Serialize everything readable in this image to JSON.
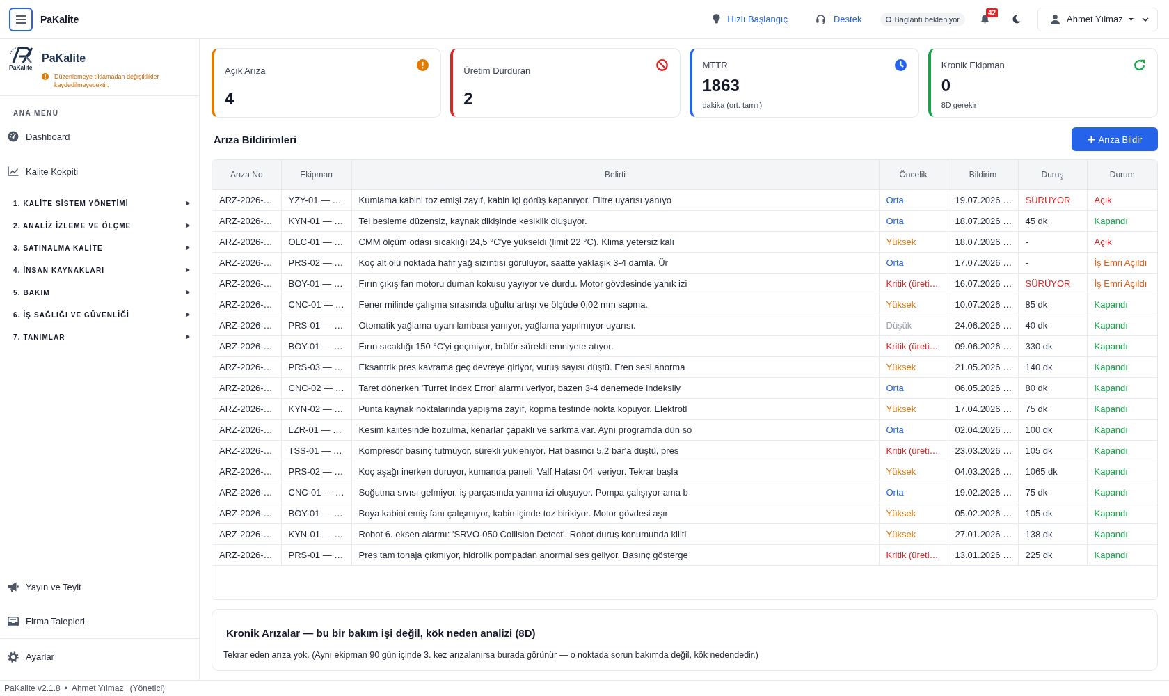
{
  "topbar": {
    "brand": "PaKalite",
    "links": [
      "Hızlı Başlangıç",
      "Destek"
    ],
    "connection_status": "Bağlantı bekleniyor",
    "notification_count": "42",
    "user": "Ahmet Yılmaz"
  },
  "sidebar": {
    "logo_caption": "PaKalite",
    "title": "PaKalite",
    "notice": "Düzenlemeye tıklamadan değişiklikler kaydedilmeyecektir.",
    "menu_heading": "ANA MENÜ",
    "items": [
      {
        "label": "Dashboard"
      },
      {
        "label": "Kalite Kokpiti"
      }
    ],
    "sections": [
      {
        "label": "1. KALİTE SİSTEM YÖNETİMİ",
        "expanded": false
      },
      {
        "label": "2. ANALİZ İZLEME VE ÖLÇME",
        "expanded": false
      },
      {
        "label": "3. SATINALMA KALİTE",
        "expanded": false
      },
      {
        "label": "4. İNSAN KAYNAKLARI",
        "expanded": false
      },
      {
        "label": "5. BAKIM",
        "expanded": false
      },
      {
        "label": "6. İŞ SAĞLIĞI VE GÜVENLİĞİ",
        "expanded": false
      },
      {
        "label": "7. TANIMLAR",
        "expanded": false
      }
    ],
    "bottom_items": [
      {
        "label": "Yayın ve Teyit"
      },
      {
        "label": "Firma Talepleri"
      }
    ],
    "settings": "Ayarlar"
  },
  "kpis": [
    {
      "title": "Açık Arıza",
      "value": "4",
      "color": "#e07b00"
    },
    {
      "title": "Üretim Durduran",
      "value": "2",
      "color": "#dc2626"
    },
    {
      "title": "MTTR",
      "value": "1863",
      "subtitle": "dakika (ort. tamir)",
      "color": "#2563eb"
    },
    {
      "title": "Kronik Ekipman",
      "value": "0",
      "subtitle": "8D gerekir",
      "color": "#16a34a"
    }
  ],
  "faults": {
    "title": "Arıza Bildirimleri",
    "add_button": "Arıza Bildir",
    "table": {
      "columns": [
        "Arıza No",
        "Ekipman",
        "Belirti",
        "Öncelik",
        "Bildirim",
        "Duruş",
        "Durum"
      ],
      "rows": [
        {
          "id": "ARZ-2026-…",
          "equipment": "YZY-01 — …",
          "symptom": "Kumlama kabini toz emişi zayıf, kabin içi görüş kapanıyor. Filtre uyarısı yanıyo",
          "priority": {
            "text": "Orta",
            "color": "#2563eb"
          },
          "reported": "19.07.2026 …",
          "downtime": {
            "text": "SÜRÜYOR",
            "ongoing": true
          },
          "status": {
            "text": "Açık",
            "color": "#dc2626"
          }
        },
        {
          "id": "ARZ-2026-…",
          "equipment": "KYN-01 — …",
          "symptom": "Tel besleme düzensiz, kaynak dikişinde kesiklik oluşuyor.",
          "priority": {
            "text": "Orta",
            "color": "#2563eb"
          },
          "reported": "18.07.2026 …",
          "downtime": {
            "text": "45 dk",
            "ongoing": false
          },
          "status": {
            "text": "Kapandı",
            "color": "#16a34a"
          }
        },
        {
          "id": "ARZ-2026-…",
          "equipment": "OLC-01 — …",
          "symptom": "CMM ölçüm odası sıcaklığı 24,5 °C'ye yükseldi (limit 22 °C). Klima yetersiz kalı",
          "priority": {
            "text": "Yüksek",
            "color": "#d97706"
          },
          "reported": "18.07.2026 …",
          "downtime": {
            "text": "-",
            "ongoing": false
          },
          "status": {
            "text": "Açık",
            "color": "#dc2626"
          }
        },
        {
          "id": "ARZ-2026-…",
          "equipment": "PRS-02 — …",
          "symptom": "Koç alt ölü noktada hafif yağ sızıntısı görülüyor, saatte yaklaşık 3-4 damla. Ür",
          "priority": {
            "text": "Orta",
            "color": "#2563eb"
          },
          "reported": "17.07.2026 …",
          "downtime": {
            "text": "-",
            "ongoing": false
          },
          "status": {
            "text": "İş Emri Açıldı",
            "color": "#ea580c"
          }
        },
        {
          "id": "ARZ-2026-…",
          "equipment": "BOY-01 — …",
          "symptom": "Fırın çıkış fan motoru duman kokusu yayıyor ve durdu. Motor gövdesinde yanık izi",
          "priority": {
            "text": "Kritik (üreti…",
            "color": "#dc2626"
          },
          "reported": "16.07.2026 …",
          "downtime": {
            "text": "SÜRÜYOR",
            "ongoing": true
          },
          "status": {
            "text": "İş Emri Açıldı",
            "color": "#ea580c"
          }
        },
        {
          "id": "ARZ-2026-…",
          "equipment": "CNC-01 — …",
          "symptom": "Fener milinde çalışma sırasında uğultu artışı ve ölçüde 0,02 mm sapma.",
          "priority": {
            "text": "Yüksek",
            "color": "#d97706"
          },
          "reported": "10.07.2026 …",
          "downtime": {
            "text": "85 dk",
            "ongoing": false
          },
          "status": {
            "text": "Kapandı",
            "color": "#16a34a"
          }
        },
        {
          "id": "ARZ-2026-…",
          "equipment": "PRS-01 — …",
          "symptom": "Otomatik yağlama uyarı lambası yanıyor, yağlama yapılmıyor uyarısı.",
          "priority": {
            "text": "Düşük",
            "color": "#9ca3af"
          },
          "reported": "24.06.2026 …",
          "downtime": {
            "text": "40 dk",
            "ongoing": false
          },
          "status": {
            "text": "Kapandı",
            "color": "#16a34a"
          }
        },
        {
          "id": "ARZ-2026-…",
          "equipment": "BOY-01 — …",
          "symptom": "Fırın sıcaklığı 150 °C'yi geçmiyor, brülör sürekli emniyete atıyor.",
          "priority": {
            "text": "Kritik (üreti…",
            "color": "#dc2626"
          },
          "reported": "09.06.2026 …",
          "downtime": {
            "text": "330 dk",
            "ongoing": false
          },
          "status": {
            "text": "Kapandı",
            "color": "#16a34a"
          }
        },
        {
          "id": "ARZ-2026-…",
          "equipment": "PRS-03 — …",
          "symptom": "Eksantrik pres kavrama geç devreye giriyor, vuruş sayısı düştü. Fren sesi anorma",
          "priority": {
            "text": "Yüksek",
            "color": "#d97706"
          },
          "reported": "21.05.2026 …",
          "downtime": {
            "text": "140 dk",
            "ongoing": false
          },
          "status": {
            "text": "Kapandı",
            "color": "#16a34a"
          }
        },
        {
          "id": "ARZ-2026-…",
          "equipment": "CNC-02 — …",
          "symptom": "Taret dönerken 'Turret Index Error' alarmı veriyor, bazen 3-4 denemede indeksliy",
          "priority": {
            "text": "Orta",
            "color": "#2563eb"
          },
          "reported": "06.05.2026 …",
          "downtime": {
            "text": "80 dk",
            "ongoing": false
          },
          "status": {
            "text": "Kapandı",
            "color": "#16a34a"
          }
        },
        {
          "id": "ARZ-2026-…",
          "equipment": "KYN-02 — …",
          "symptom": "Punta kaynak noktalarında yapışma zayıf, kopma testinde nokta kopuyor. Elektrotl",
          "priority": {
            "text": "Yüksek",
            "color": "#d97706"
          },
          "reported": "17.04.2026 …",
          "downtime": {
            "text": "75 dk",
            "ongoing": false
          },
          "status": {
            "text": "Kapandı",
            "color": "#16a34a"
          }
        },
        {
          "id": "ARZ-2026-…",
          "equipment": "LZR-01 — …",
          "symptom": "Kesim kalitesinde bozulma, kenarlar çapaklı ve sarkma var. Aynı programda dün so",
          "priority": {
            "text": "Orta",
            "color": "#2563eb"
          },
          "reported": "02.04.2026 …",
          "downtime": {
            "text": "100 dk",
            "ongoing": false
          },
          "status": {
            "text": "Kapandı",
            "color": "#16a34a"
          }
        },
        {
          "id": "ARZ-2026-…",
          "equipment": "TSS-01 — …",
          "symptom": "Kompresör basınç tutmuyor, sürekli yükleniyor. Hat basıncı 5,2 bar'a düştü, pres",
          "priority": {
            "text": "Kritik (üreti…",
            "color": "#dc2626"
          },
          "reported": "23.03.2026 …",
          "downtime": {
            "text": "105 dk",
            "ongoing": false
          },
          "status": {
            "text": "Kapandı",
            "color": "#16a34a"
          }
        },
        {
          "id": "ARZ-2026-…",
          "equipment": "PRS-02 — …",
          "symptom": "Koç aşağı inerken duruyor, kumanda paneli 'Valf Hatası 04' veriyor. Tekrar başla",
          "priority": {
            "text": "Yüksek",
            "color": "#d97706"
          },
          "reported": "04.03.2026 …",
          "downtime": {
            "text": "1065 dk",
            "ongoing": false
          },
          "status": {
            "text": "Kapandı",
            "color": "#16a34a"
          }
        },
        {
          "id": "ARZ-2026-…",
          "equipment": "CNC-01 — …",
          "symptom": "Soğutma sıvısı gelmiyor, iş parçasında yanma izi oluşuyor. Pompa çalışıyor ama b",
          "priority": {
            "text": "Orta",
            "color": "#2563eb"
          },
          "reported": "19.02.2026 …",
          "downtime": {
            "text": "75 dk",
            "ongoing": false
          },
          "status": {
            "text": "Kapandı",
            "color": "#16a34a"
          }
        },
        {
          "id": "ARZ-2026-…",
          "equipment": "BOY-01 — …",
          "symptom": "Boya kabini emiş fanı çalışmıyor, kabin içinde toz birikiyor. Motor gövdesi aşır",
          "priority": {
            "text": "Yüksek",
            "color": "#d97706"
          },
          "reported": "05.02.2026 …",
          "downtime": {
            "text": "105 dk",
            "ongoing": false
          },
          "status": {
            "text": "Kapandı",
            "color": "#16a34a"
          }
        },
        {
          "id": "ARZ-2026-…",
          "equipment": "KYN-01 — …",
          "symptom": "Robot 6. eksen alarmı: 'SRVO-050 Collision Detect'. Robot duruş konumunda kilitl",
          "priority": {
            "text": "Yüksek",
            "color": "#d97706"
          },
          "reported": "27.01.2026 …",
          "downtime": {
            "text": "138 dk",
            "ongoing": false
          },
          "status": {
            "text": "Kapandı",
            "color": "#16a34a"
          }
        },
        {
          "id": "ARZ-2026-…",
          "equipment": "PRS-01 — …",
          "symptom": "Pres tam tonaja çıkmıyor, hidrolik pompadan anormal ses geliyor. Basınç gösterge",
          "priority": {
            "text": "Kritik (üreti…",
            "color": "#dc2626"
          },
          "reported": "13.01.2026 …",
          "downtime": {
            "text": "225 dk",
            "ongoing": false
          },
          "status": {
            "text": "Kapandı",
            "color": "#16a34a"
          }
        }
      ]
    }
  },
  "chronic": {
    "title": "Kronik Arızalar — bu bir bakım işi değil, kök neden analizi (8D)",
    "text": "Tekrar eden arıza yok. (Aynı ekipman 90 gün içinde 3. kez arızalanırsa burada görünür — o noktada sorun bakımda değil, kök nedendedir.)"
  },
  "footer": {
    "version": "PaKalite v2.1.8",
    "separator": "•",
    "user": "Ahmet Yılmaz",
    "role": "(Yönetici)"
  }
}
